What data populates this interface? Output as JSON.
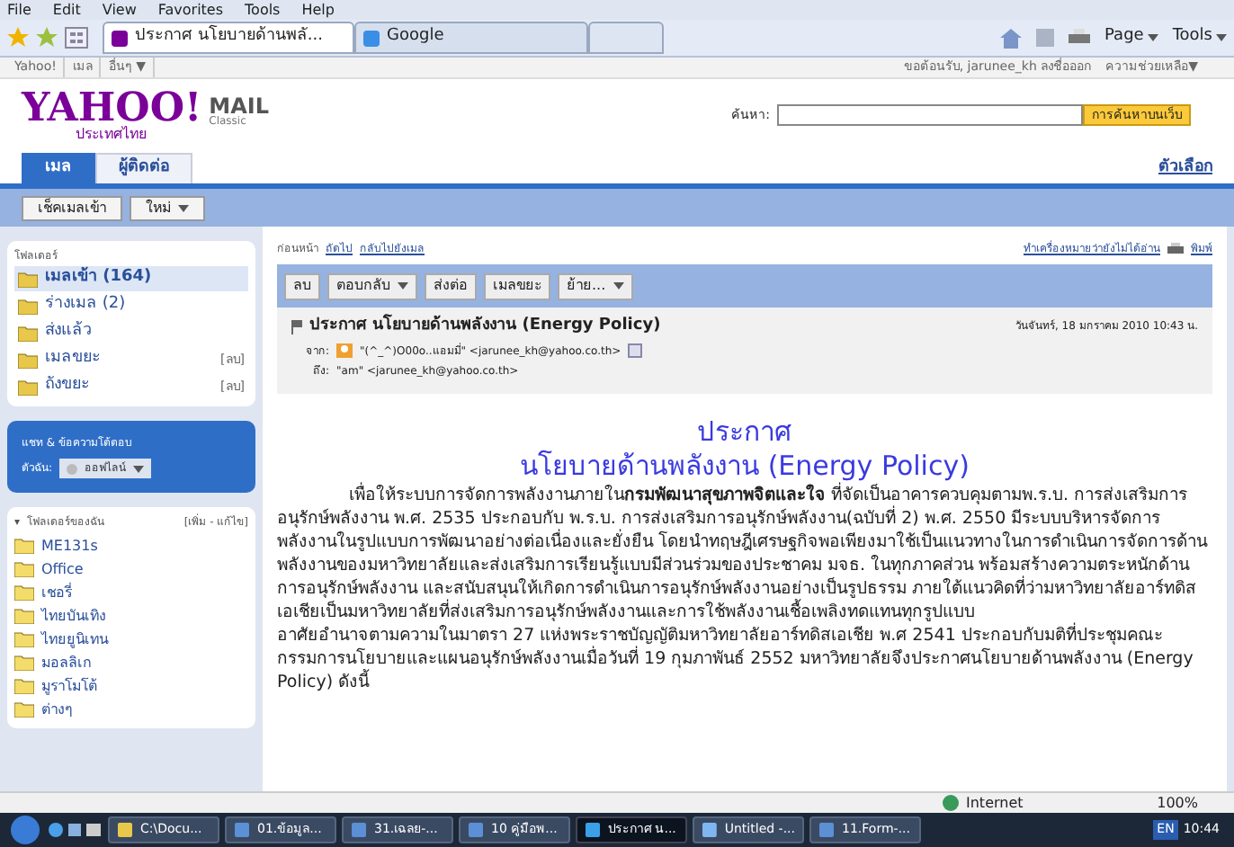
{
  "menu_bar": [
    "File",
    "Edit",
    "View",
    "Favorites",
    "Tools",
    "Help"
  ],
  "browser_tabs": [
    {
      "label": "ประกาศ นโยบายด้านพลั...",
      "selected": true
    },
    {
      "label": "Google",
      "selected": false
    }
  ],
  "browser_commands": [
    "Page",
    "Tools"
  ],
  "yahoo_bar": {
    "links": [
      "Yahoo!",
      "เมล",
      "อื่นๆ ▼"
    ],
    "welcome": "ขอต้อนรับ, jarunee_kh ลงชื่อออก",
    "help": "ความช่วยเหลือ▼"
  },
  "logo": {
    "name": "YAHOO!",
    "sub": "ประเทศไทย",
    "mail": "MAIL",
    "classic": "Classic"
  },
  "search": {
    "label": "ค้นหา:",
    "button": "การค้นหาบนเว็บ"
  },
  "mail_tabs": [
    {
      "label": "เมล",
      "selected": true
    },
    {
      "label": "ผู้ติดต่อ",
      "selected": false
    }
  ],
  "options_link": "ตัวเลือก",
  "actions": [
    "เช็คเมลเข้า",
    "ใหม่"
  ],
  "folders": {
    "title": "โฟลเดอร์",
    "items": [
      {
        "label": "เมลเข้า (164)",
        "selected": true
      },
      {
        "label": "ร่างเมล (2)",
        "selected": false
      },
      {
        "label": "ส่งแล้ว",
        "selected": false
      },
      {
        "label": "เมลขยะ",
        "selected": false,
        "action": "[ลบ]"
      },
      {
        "label": "ถังขยะ",
        "selected": false,
        "action": "[ลบ]"
      }
    ]
  },
  "chat": {
    "title": "แชท & ข้อความโต้ตอบ",
    "me": "ตัวฉัน:",
    "status": "ออฟไลน์"
  },
  "my_folders": {
    "toggle": "▾",
    "title": "โฟลเดอร์ของฉัน",
    "edit": "[เพิ่ม - แก้ไข]",
    "items": [
      "ME131s",
      "Office",
      "เชอรี่",
      "ไทยบันเทิง",
      "ไทยยูนิเทน",
      "มอลลิเก",
      "มูราโมโต้",
      "ต่างๆ"
    ]
  },
  "nav": {
    "links": [
      "ก่อนหน้า",
      "ถัดไป",
      "กลับไปยังเมล"
    ],
    "mark_unread": "ทำเครื่องหมายว่ายังไม่ได้อ่าน",
    "print": "พิมพ์"
  },
  "toolbar": [
    {
      "label": "ลบ",
      "dropdown": false
    },
    {
      "label": "ตอบกลับ",
      "dropdown": true
    },
    {
      "label": "ส่งต่อ",
      "dropdown": false
    },
    {
      "label": "เมลขยะ",
      "dropdown": false
    },
    {
      "label": "ย้าย...",
      "dropdown": true
    }
  ],
  "message": {
    "subject": "ประกาศ นโยบายด้านพลังงาน (Energy Policy)",
    "date": "วันจันทร์, 18 มกราคม 2010 10:43 น.",
    "from_label": "จาก:",
    "from": "\"(^_^)O00o..แอมมี่\" <jarunee_kh@yahoo.co.th>",
    "to_label": "ถึง:",
    "to": "\"am\" <jarunee_kh@yahoo.co.th>",
    "heading": [
      "ประกาศ",
      "นโยบายด้านพลังงาน (Energy Policy)"
    ],
    "paragraphs": [
      "เพื่อให้ระบบการจัดการพลังงานภายใน**กรมพัฒนาสุขภาพจิตและใจ** ที่จัดเป็นอาคารควบคุมตามพ.ร.บ. การส่งเสริมการอนุรักษ์พลังงาน พ.ศ. 2535 ประกอบกับ พ.ร.บ. การส่งเสริมการอนุรักษ์พลังงาน(ฉบับที่ 2) พ.ศ. 2550 มีระบบบริหารจัดการพลังงานในรูปแบบการพัฒนาอย่างต่อเนื่องและยั่งยืน โดยนำทฤษฎีเศรษฐกิจพอเพียงมาใช้เป็นแนวทางในการดำเนินการจัดการด้านพลังงานของมหาวิทยาลัยและส่งเสริมการเรียนรู้แบบมีส่วนร่วมของประชาคม มจธ. ในทุกภาคส่วน พร้อมสร้างความตระหนักด้านการอนุรักษ์พลังงาน และสนับสนุนให้เกิดการดำเนินการอนุรักษ์พลังงานอย่างเป็นรูปธรรม ภายใต้แนวคิดที่ว่ามหาวิทยาลัยอาร์ทดิสเอเชียเป็นมหาวิทยาลัยที่ส่งเสริมการอนุรักษ์พลังงานและการใช้พลังงานเชื้อเพลิงทดแทนทุกรูปแบบ",
      "อาศัยอำนาจตามความในมาตรา 27 แห่งพระราชบัญญัติมหาวิทยาลัยอาร์ทดิสเอเชีย พ.ศ 2541 ประกอบกับมติที่ประชุมคณะกรรมการนโยบายและแผนอนุรักษ์พลังงานเมื่อวันที่ 19 กุมภาพันธ์ 2552 มหาวิทยาลัยจึงประกาศนโยบายด้านพลังงาน (Energy Policy) ดังนี้"
    ]
  },
  "status_bar": {
    "zone": "Internet",
    "zoom": "100%"
  },
  "taskbar": {
    "items": [
      {
        "label": "C:\\Docu...",
        "kind": "folder",
        "selected": false
      },
      {
        "label": "01.ข้อมูล...",
        "kind": "doc",
        "selected": false
      },
      {
        "label": "31.เฉลย-...",
        "kind": "doc",
        "selected": false
      },
      {
        "label": "10 คู่มือพ...",
        "kind": "doc",
        "selected": false
      },
      {
        "label": "ประกาศ น...",
        "kind": "ie",
        "selected": true
      },
      {
        "label": "Untitled -...",
        "kind": "paint",
        "selected": false
      },
      {
        "label": "11.Form-...",
        "kind": "doc",
        "selected": false
      }
    ],
    "lang": "EN",
    "time": "10:44"
  }
}
